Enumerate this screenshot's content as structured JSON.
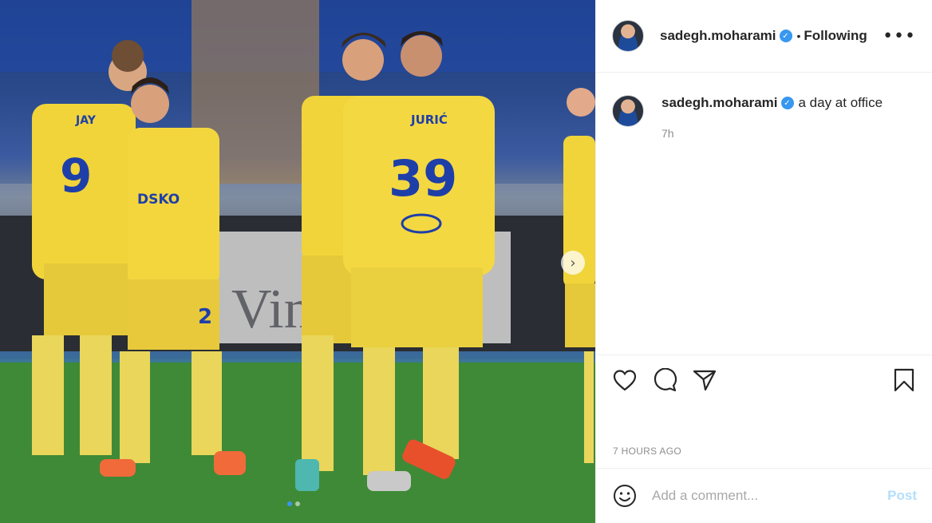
{
  "post": {
    "username": "sadegh.moharami",
    "follow_status": "Following",
    "separator": "•",
    "caption": "a day at office",
    "time_short": "7h",
    "time_long": "7 HOURS AGO",
    "more_label": "•••",
    "verified_mark": "✓"
  },
  "photo": {
    "jersey_name_front": "JURIĆ",
    "jersey_number_front": "39",
    "jersey_name_left": "JAY",
    "jersey_number_left": "9",
    "shorts_number": "2",
    "sponsor": "DSKO",
    "next_arrow": "›",
    "carousel_dots": 2,
    "carousel_active": 1
  },
  "comment_box": {
    "placeholder": "Add a comment...",
    "post_label": "Post"
  },
  "colors": {
    "accent": "#3897f0",
    "post_disabled": "#b2dffc",
    "jersey_yellow": "#f0d43a",
    "jersey_blue": "#1f3fa8"
  },
  "icons": [
    "heart-icon",
    "comment-icon",
    "share-icon",
    "bookmark-icon",
    "emoji-icon",
    "more-icon",
    "verified-icon"
  ]
}
